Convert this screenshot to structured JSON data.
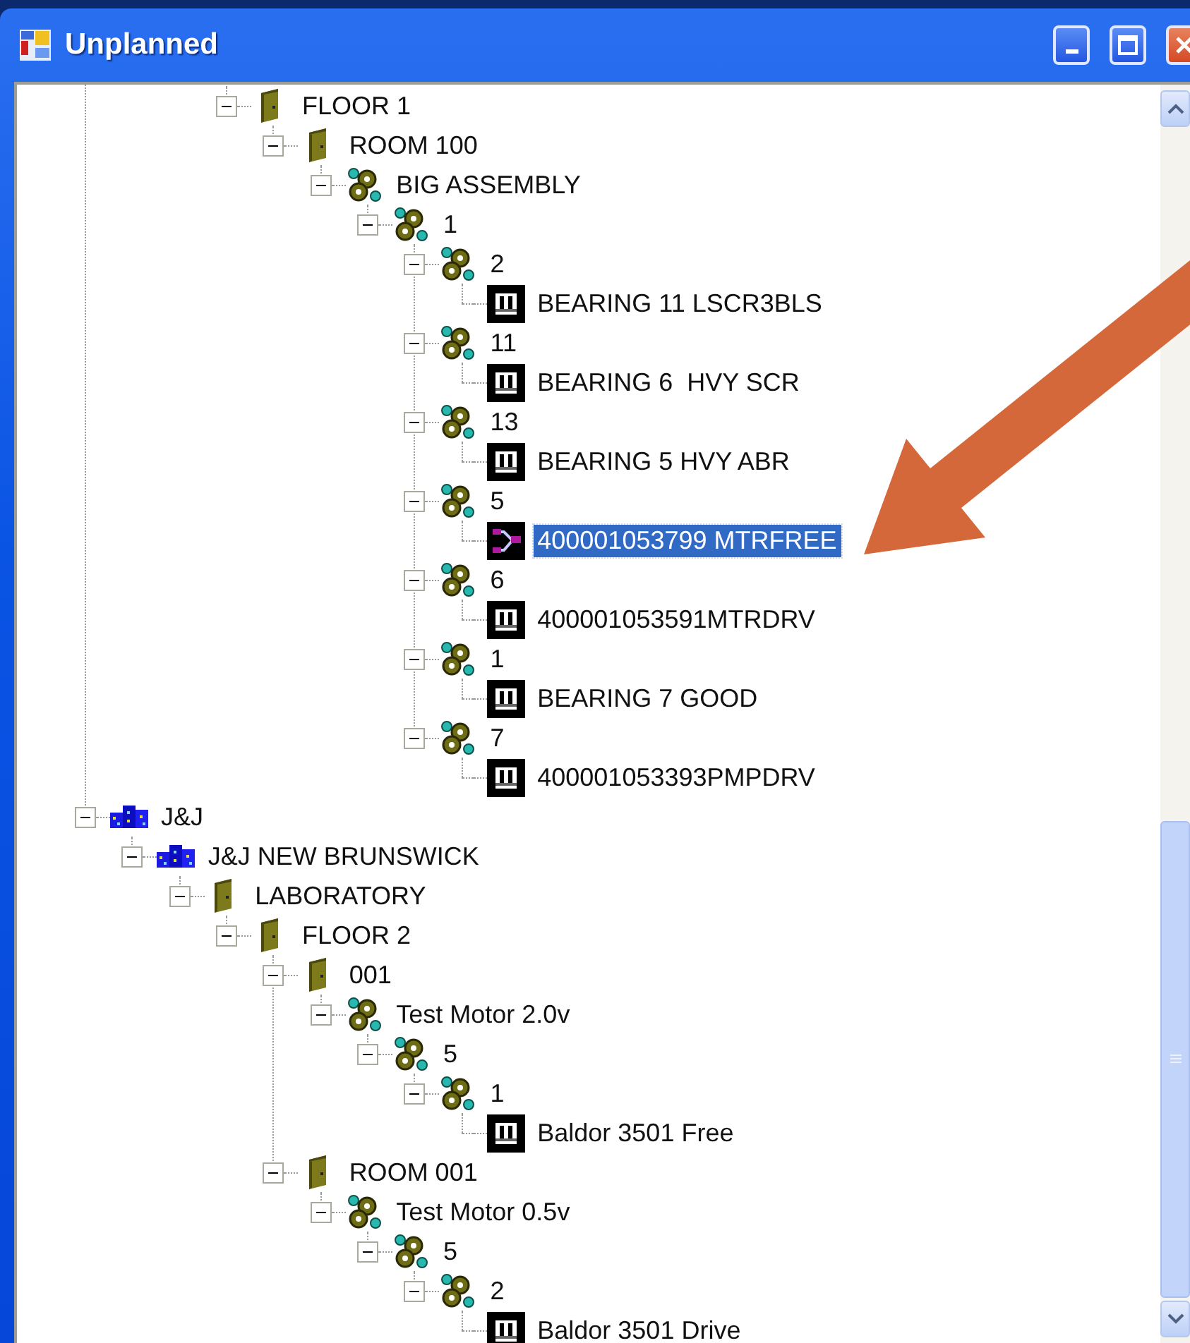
{
  "window": {
    "title": "Unplanned"
  },
  "tree": {
    "continued": [
      {
        "label": "FLOOR 1",
        "kind": "door",
        "expanded": true,
        "selected": false,
        "children": [
          {
            "label": "ROOM 100",
            "kind": "door",
            "expanded": true,
            "selected": false,
            "children": [
              {
                "label": "BIG ASSEMBLY",
                "kind": "gears",
                "expanded": true,
                "selected": false,
                "children": [
                  {
                    "label": "1",
                    "kind": "gears",
                    "expanded": true,
                    "selected": false,
                    "children": [
                      {
                        "label": "2",
                        "kind": "gears",
                        "expanded": true,
                        "selected": false,
                        "children": [
                          {
                            "label": "BEARING 11 LSCR3BLS",
                            "kind": "bearing",
                            "selected": false
                          }
                        ]
                      },
                      {
                        "label": "11",
                        "kind": "gears",
                        "expanded": true,
                        "selected": false,
                        "children": [
                          {
                            "label": "BEARING 6  HVY SCR",
                            "kind": "bearing",
                            "selected": false
                          }
                        ]
                      },
                      {
                        "label": "13",
                        "kind": "gears",
                        "expanded": true,
                        "selected": false,
                        "children": [
                          {
                            "label": "BEARING 5 HVY ABR",
                            "kind": "bearing",
                            "selected": false
                          }
                        ]
                      },
                      {
                        "label": "5",
                        "kind": "gears",
                        "expanded": true,
                        "selected": false,
                        "children": [
                          {
                            "label": "400001053799 MTRFREE",
                            "kind": "motor",
                            "selected": true
                          }
                        ]
                      },
                      {
                        "label": "6",
                        "kind": "gears",
                        "expanded": true,
                        "selected": false,
                        "children": [
                          {
                            "label": "400001053591MTRDRV",
                            "kind": "bearing",
                            "selected": false
                          }
                        ]
                      },
                      {
                        "label": "1",
                        "kind": "gears",
                        "expanded": true,
                        "selected": false,
                        "children": [
                          {
                            "label": "BEARING 7 GOOD",
                            "kind": "bearing",
                            "selected": false
                          }
                        ]
                      },
                      {
                        "label": "7",
                        "kind": "gears",
                        "expanded": true,
                        "selected": false,
                        "children": [
                          {
                            "label": "400001053393PMPDRV",
                            "kind": "bearing",
                            "selected": false
                          }
                        ]
                      }
                    ]
                  }
                ]
              }
            ]
          }
        ]
      }
    ],
    "nodes": [
      {
        "label": "J&J",
        "kind": "building",
        "expanded": true,
        "selected": false,
        "children": [
          {
            "label": "J&J NEW BRUNSWICK",
            "kind": "building",
            "expanded": true,
            "selected": false,
            "children": [
              {
                "label": "LABORATORY",
                "kind": "door",
                "expanded": true,
                "selected": false,
                "children": [
                  {
                    "label": "FLOOR 2",
                    "kind": "door",
                    "expanded": true,
                    "selected": false,
                    "children": [
                      {
                        "label": "001",
                        "kind": "door",
                        "expanded": true,
                        "selected": false,
                        "children": [
                          {
                            "label": "Test Motor 2.0v",
                            "kind": "gears",
                            "expanded": true,
                            "selected": false,
                            "children": [
                              {
                                "label": "5",
                                "kind": "gears",
                                "expanded": true,
                                "selected": false,
                                "children": [
                                  {
                                    "label": "1",
                                    "kind": "gears",
                                    "expanded": true,
                                    "selected": false,
                                    "children": [
                                      {
                                        "label": "Baldor 3501 Free",
                                        "kind": "bearing",
                                        "selected": false
                                      }
                                    ]
                                  }
                                ]
                              }
                            ]
                          }
                        ]
                      },
                      {
                        "label": "ROOM 001",
                        "kind": "door",
                        "expanded": true,
                        "selected": false,
                        "children": [
                          {
                            "label": "Test Motor 0.5v",
                            "kind": "gears",
                            "expanded": true,
                            "selected": false,
                            "children": [
                              {
                                "label": "5",
                                "kind": "gears",
                                "expanded": true,
                                "selected": false,
                                "children": [
                                  {
                                    "label": "2",
                                    "kind": "gears",
                                    "expanded": true,
                                    "selected": false,
                                    "children": [
                                      {
                                        "label": "Baldor 3501 Drive",
                                        "kind": "bearing",
                                        "selected": false
                                      }
                                    ]
                                  }
                                ]
                              }
                            ]
                          }
                        ]
                      }
                    ]
                  }
                ]
              }
            ]
          }
        ]
      }
    ]
  }
}
